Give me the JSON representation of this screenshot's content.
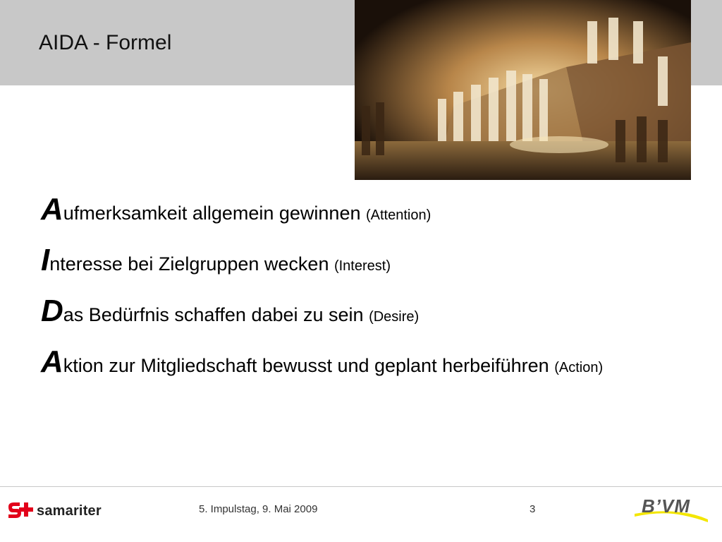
{
  "slide": {
    "title": "AIDA - Formel",
    "photo_alt": "opera-stage-scene"
  },
  "aida": [
    {
      "initial": "A",
      "rest": "ufmerksamkeit allgemein gewinnen ",
      "english": "(Attention)"
    },
    {
      "initial": "I",
      "rest": "nteresse bei Zielgruppen wecken ",
      "english": "(Interest)"
    },
    {
      "initial": "D",
      "rest": "as Bedürfnis schaffen dabei zu sein ",
      "english": "(Desire)"
    },
    {
      "initial": "A",
      "rest": "ktion zur Mitgliedschaft bewusst und geplant herbeiführen ",
      "english": "(Action)"
    }
  ],
  "footer": {
    "event": "5. Impulstag, 9. Mai 2009",
    "page_number": "3",
    "logo_left": "samariter",
    "logo_right": "B’VM"
  },
  "colors": {
    "header_band": "#c8c8c8",
    "samariter_red": "#e2001a",
    "bvm_yellow": "#f3e600"
  }
}
